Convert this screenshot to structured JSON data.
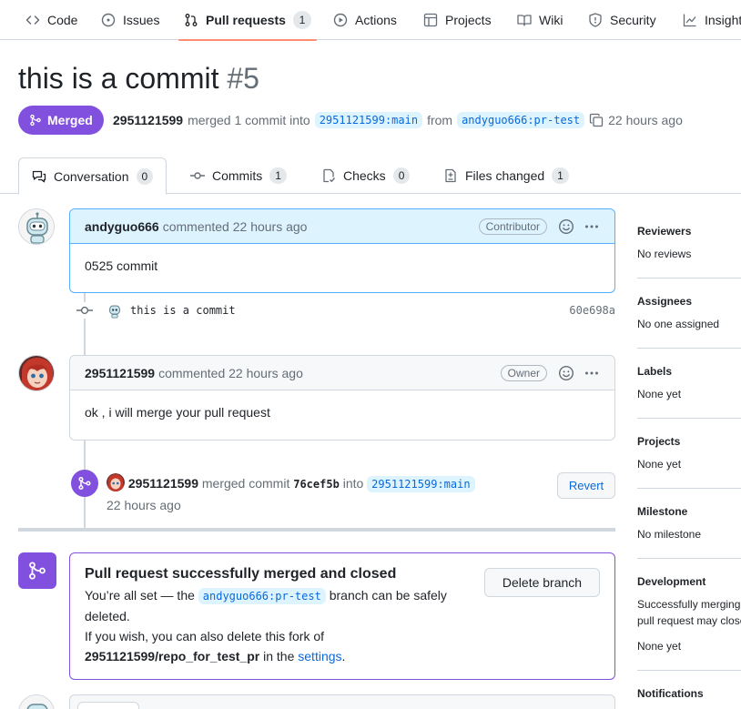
{
  "nav": {
    "items": [
      {
        "label": "Code",
        "icon": "code-icon"
      },
      {
        "label": "Issues",
        "icon": "issue-icon"
      },
      {
        "label": "Pull requests",
        "icon": "pull-request-icon",
        "count": "1",
        "active": true
      },
      {
        "label": "Actions",
        "icon": "play-icon"
      },
      {
        "label": "Projects",
        "icon": "table-icon"
      },
      {
        "label": "Wiki",
        "icon": "book-icon"
      },
      {
        "label": "Security",
        "icon": "shield-icon"
      },
      {
        "label": "Insights",
        "icon": "graph-icon"
      }
    ]
  },
  "pr": {
    "title": "this is a commit",
    "number": "#5",
    "state": "Merged",
    "author": "2951121599",
    "summary": "merged 1 commit into",
    "base": "2951121599:main",
    "from": "from",
    "head": "andyguo666:pr-test",
    "time": "22 hours ago"
  },
  "tabs": [
    {
      "label": "Conversation",
      "count": "0",
      "icon": "conversation-icon"
    },
    {
      "label": "Commits",
      "count": "1",
      "icon": "commit-icon"
    },
    {
      "label": "Checks",
      "count": "0",
      "icon": "checklist-icon"
    },
    {
      "label": "Files changed",
      "count": "1",
      "icon": "diff-icon"
    }
  ],
  "timeline": {
    "comment1": {
      "author": "andyguo666",
      "meta": "commented 22 hours ago",
      "role": "Contributor",
      "body": "0525 commit"
    },
    "commit": {
      "message": "this is a commit",
      "sha": "60e698a"
    },
    "comment2": {
      "author": "2951121599",
      "meta": "commented 22 hours ago",
      "role": "Owner",
      "body": "ok , i will merge your pull request"
    },
    "merge": {
      "actor": "2951121599",
      "text": "merged commit",
      "sha": "76cef5b",
      "into": "into",
      "branch": "2951121599:main",
      "time": "22 hours ago",
      "revert_label": "Revert"
    }
  },
  "merged_box": {
    "title": "Pull request successfully merged and closed",
    "line1_pre": "You’re all set — the",
    "branch": "andyguo666:pr-test",
    "line1_post": "branch can be safely deleted.",
    "line2_pre": "If you wish, you can also delete this fork of",
    "repo": "2951121599/repo_for_test_pr",
    "line2_mid": "in the",
    "settings": "settings",
    "line2_end": ".",
    "delete_label": "Delete branch"
  },
  "sidebar": {
    "reviewers": {
      "title": "Reviewers",
      "value": "No reviews"
    },
    "assignees": {
      "title": "Assignees",
      "value": "No one assigned"
    },
    "labels": {
      "title": "Labels",
      "value": "None yet"
    },
    "projects": {
      "title": "Projects",
      "value": "None yet"
    },
    "milestone": {
      "title": "Milestone",
      "value": "No milestone"
    },
    "development": {
      "title": "Development",
      "value": "Successfully merging this pull request may close these issues.",
      "value2": "None yet"
    },
    "notifications": {
      "title": "Notifications"
    }
  },
  "colors": {
    "merged": "#8250df",
    "link": "#0969da",
    "accent_underline": "#fd8c73"
  }
}
